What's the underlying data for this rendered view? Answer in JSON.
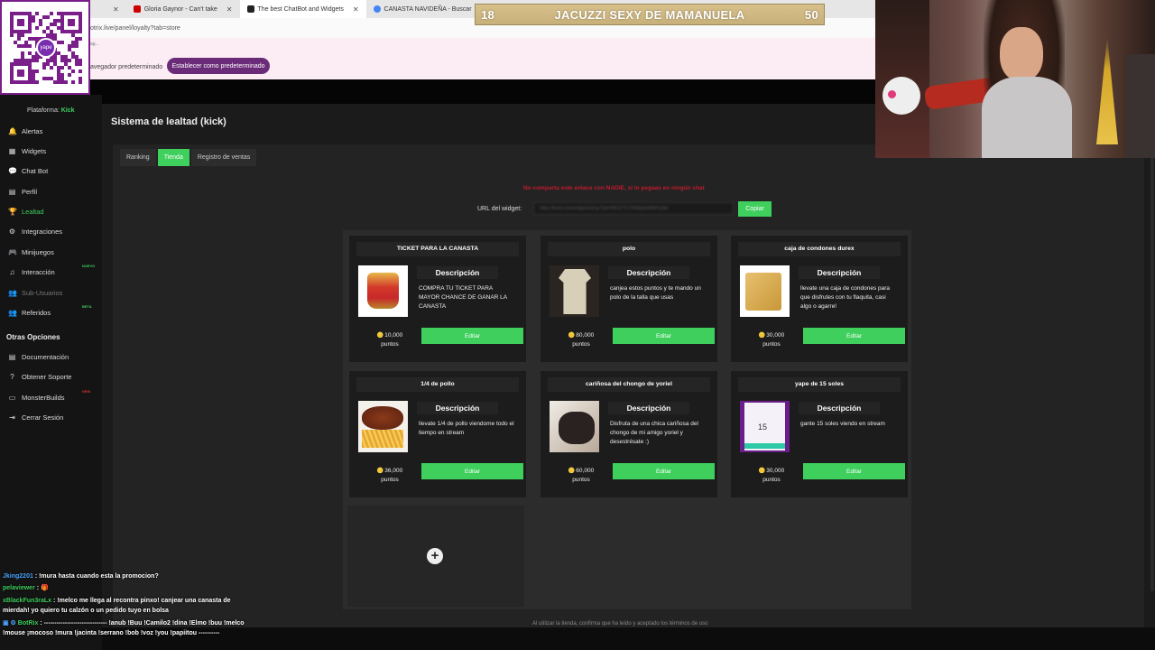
{
  "browser": {
    "tabs": [
      {
        "label": "Gloria Gaynor - Can't take",
        "active": false,
        "color": "#cc0000"
      },
      {
        "label": "The best ChatBot and Widgets",
        "active": true,
        "color": "#222222"
      },
      {
        "label": "CANASTA NAVIDEÑA - Buscar",
        "active": false,
        "color": "#4285f4"
      }
    ],
    "new_tab": "+",
    "close_glyph": "✕",
    "address": "otrix.live/panel/loyalty?tab=store",
    "notif_small": "ag...",
    "notif_text": "avegador predeterminado",
    "notif_button": "Establecer como predeterminado"
  },
  "banner": {
    "left_num": "18",
    "text": "JACUZZI SEXY DE MAMANUELA",
    "right_num": "50"
  },
  "qr": {
    "label": "yape"
  },
  "sidebar": {
    "platform_label": "Plataforma:",
    "platform_value": "Kick",
    "items": [
      {
        "label": "Alertas",
        "icon": "bell-icon",
        "glyph": "🔔",
        "state": "normal"
      },
      {
        "label": "Widgets",
        "icon": "grid-icon",
        "glyph": "▦",
        "state": "normal"
      },
      {
        "label": "Chat Bot",
        "icon": "chat-icon",
        "glyph": "💬",
        "state": "normal"
      },
      {
        "label": "Perfil",
        "icon": "profile-icon",
        "glyph": "▤",
        "state": "normal"
      },
      {
        "label": "Lealtad",
        "icon": "trophy-icon",
        "glyph": "🏆",
        "state": "active"
      },
      {
        "label": "Integraciones",
        "icon": "integrations-icon",
        "glyph": "⚙",
        "state": "normal"
      },
      {
        "label": "Minijuegos",
        "icon": "gamepad-icon",
        "glyph": "🎮",
        "state": "normal"
      },
      {
        "label": "Interacción",
        "icon": "music-icon",
        "glyph": "♫",
        "state": "normal",
        "badge": "NUEVO"
      },
      {
        "label": "Sub-Usuarios",
        "icon": "users-icon",
        "glyph": "👥",
        "state": "muted"
      },
      {
        "label": "Referidos",
        "icon": "referral-icon",
        "glyph": "👥",
        "state": "normal",
        "badge": "BETA"
      }
    ],
    "other_title": "Otras Opciones",
    "other_items": [
      {
        "label": "Documentación",
        "icon": "docs-icon",
        "glyph": "▤"
      },
      {
        "label": "Obtener Soporte",
        "icon": "help-icon",
        "glyph": "?"
      },
      {
        "label": "MonsterBuilds",
        "icon": "monitor-icon",
        "glyph": "▭",
        "badge": "NEW"
      },
      {
        "label": "Cerrar Sesión",
        "icon": "logout-icon",
        "glyph": "⇥"
      }
    ]
  },
  "main": {
    "title": "Sistema de lealtad (kick)",
    "tabs": [
      {
        "label": "Ranking",
        "active": false
      },
      {
        "label": "Tienda",
        "active": true
      },
      {
        "label": "Registro de ventas",
        "active": false
      }
    ],
    "warning": "No comparta este enlace con NADIE, si lo pegaas en ningún chat",
    "url_label": "URL del widget:",
    "url_value": "https://botrix.live/widgets/shop?bid=RKQ7TCY6MQbdxB5Pa2da",
    "copy_button": "Copiar",
    "footer_note": "Al utilizar la tienda, confirma que ha leído y aceptado los términos de uso"
  },
  "store": {
    "desc_title": "Descripción",
    "edit_label": "Editar",
    "points_label": "puntos",
    "add_icon": "plus-circle-icon",
    "products": [
      {
        "title": "TICKET PARA LA CANASTA",
        "description": "COMPRA TU TICKET PARA MAYOR CHANCE DE GANAR LA CANASTA",
        "price": "10,000",
        "image": "gift-basket"
      },
      {
        "title": "polo",
        "description": "canjea estos puntos y te mando un polo de la talla que usas",
        "price": "80,000",
        "image": "tshirt"
      },
      {
        "title": "caja de condones durex",
        "description": "llevate una caja de condones para que disfrutes con tu flaquita, casi algo o agarre!",
        "price": "30,000",
        "image": "durex-box"
      },
      {
        "title": "1/4 de pollo",
        "description": "llevate 1/4 de pollo viendome todo el tiempo en stream",
        "price": "36,000",
        "image": "roast-chicken"
      },
      {
        "title": "cariñosa del chongo de yoriel",
        "description": "Disfruta de una chica cariñosa del chongo de mi amigo yoriel y desestrésate :)",
        "price": "60,000",
        "image": "photo"
      },
      {
        "title": "yape de 15 soles",
        "description": "gante 15 soles viendo en stream",
        "price": "30,000",
        "image": "yape-screenshot"
      }
    ]
  },
  "chat": [
    {
      "user": "Jking2201",
      "user_color": "#4aa3ff",
      "text": ": !mura hasta cuando esta la promocion?"
    },
    {
      "user": "pelaviewer",
      "user_color": "#3ecf5c",
      "text": ": 🎁"
    },
    {
      "user": "xBlackFun3raLx",
      "user_color": "#3ecf5c",
      "text": ": !melco me llega al recontra pinxo! canjear una canasta de mierdah! yo quiero tu calzón o un pedido tuyo en bolsa"
    },
    {
      "user": "BotRix",
      "user_color": "#3ecf5c",
      "text": ": ------------------------------ !anub !Buu !Camilo2 !dina !Elmo !buu !melco !mouse ¡mocoso !mura !jacinta !serrano !bob !voz !you !papiitou ----------"
    }
  ],
  "colors": {
    "accent": "#3ecf5c",
    "warning": "#c01b2e",
    "notif_btn": "#6a2c78"
  }
}
